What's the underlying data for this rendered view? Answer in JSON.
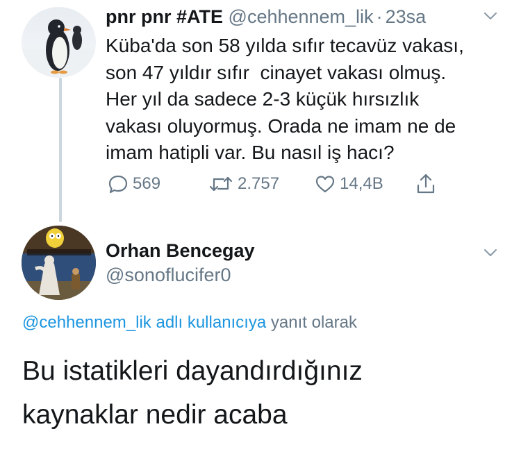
{
  "tweet": {
    "display_name": "pnr pnr #ATE",
    "handle": "@cehhennem_lik",
    "separator": "·",
    "time": "23sa",
    "text_lines": [
      "Küba'da son 58 yılda sıfır tecavüz vakası,",
      "son 47 yıldır sıfır  cinayet vakası olmuş.",
      "Her yıl da sadece 2-3 küçük hırsızlık",
      "vakası oluyormuş. Orada ne imam ne de",
      "imam hatipli var. Bu nasıl iş hacı?"
    ],
    "replies": "569",
    "retweets": "2.757",
    "likes": "14,4B"
  },
  "reply_tweet": {
    "display_name": "Orhan Bencegay",
    "handle": "@sonoflucifer0",
    "replying_to_link": "@cehhennem_lik adlı kullanıcıya",
    "replying_to_suffix": "yanıt olarak",
    "text_lines": [
      "Bu istatikleri dayandırdığınız",
      "kaynaklar nedir acaba"
    ]
  },
  "colors": {
    "link_blue": "#1b95e0",
    "secondary_gray": "#657786",
    "text_dark": "#14171a",
    "thread_line": "#ccd6dd"
  },
  "icons": [
    "penguin-avatar",
    "simpsons-avatar",
    "chevron-down-icon",
    "reply-icon",
    "retweet-icon",
    "like-icon",
    "share-icon"
  ]
}
